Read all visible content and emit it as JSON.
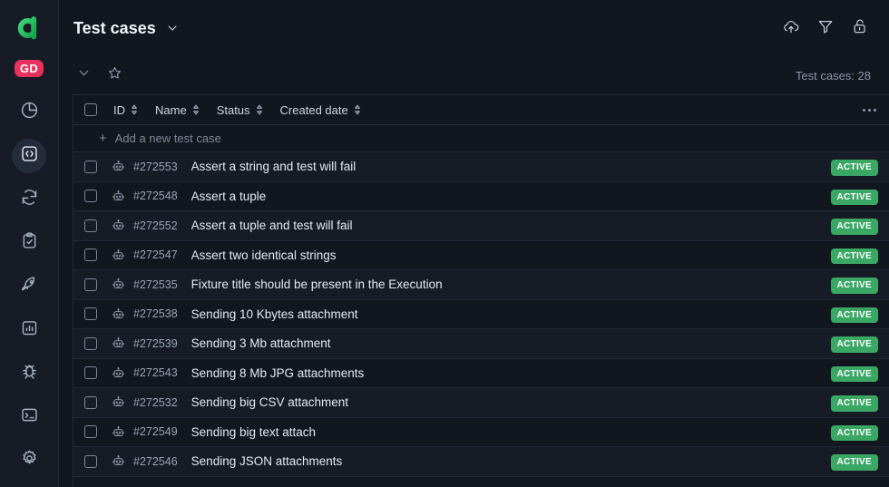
{
  "sidebar": {
    "logo_icon": "allure-logo-icon",
    "avatar_initials": "GD",
    "items": [
      {
        "icon": "pie-chart-icon",
        "name": "dashboards",
        "active": false
      },
      {
        "icon": "code-brackets-icon",
        "name": "test-cases",
        "active": true
      },
      {
        "icon": "sync-icon",
        "name": "launches",
        "active": false
      },
      {
        "icon": "clipboard-check-icon",
        "name": "test-plans",
        "active": false
      },
      {
        "icon": "rocket-icon",
        "name": "jobs",
        "active": false
      },
      {
        "icon": "bar-chart-icon",
        "name": "analytics",
        "active": false
      },
      {
        "icon": "bug-icon",
        "name": "defects",
        "active": false
      },
      {
        "icon": "terminal-icon",
        "name": "console",
        "active": false
      },
      {
        "icon": "gear-icon",
        "name": "settings",
        "active": false
      }
    ]
  },
  "topbar": {
    "title": "Test cases",
    "title_chevron_icon": "chevron-down-icon",
    "actions": [
      {
        "icon": "cloud-upload-icon",
        "name": "upload-button"
      },
      {
        "icon": "filter-icon",
        "name": "filter-button"
      },
      {
        "icon": "unlock-icon",
        "name": "lock-button"
      }
    ]
  },
  "subbar": {
    "collapse_icon": "chevron-down-icon",
    "favorite_icon": "star-icon",
    "count_label": "Test cases: 28"
  },
  "table": {
    "select_all_name": "select-all-checkbox",
    "columns": [
      {
        "label": "ID",
        "sortable": true
      },
      {
        "label": "Name",
        "sortable": true
      },
      {
        "label": "Status",
        "sortable": true
      },
      {
        "label": "Created date",
        "sortable": true
      }
    ],
    "more_menu_icon": "more-options-icon",
    "add_row": {
      "icon": "plus-icon",
      "label": "Add a new test case"
    },
    "row_icon": "robot-icon",
    "rows": [
      {
        "id": "#272553",
        "name": "Assert a string and test will fail",
        "status": "ACTIVE"
      },
      {
        "id": "#272548",
        "name": "Assert a tuple",
        "status": "ACTIVE"
      },
      {
        "id": "#272552",
        "name": "Assert a tuple and test will fail",
        "status": "ACTIVE"
      },
      {
        "id": "#272547",
        "name": "Assert two identical strings",
        "status": "ACTIVE"
      },
      {
        "id": "#272535",
        "name": "Fixture title should be present in the Execution",
        "status": "ACTIVE"
      },
      {
        "id": "#272538",
        "name": "Sending 10 Kbytes attachment",
        "status": "ACTIVE"
      },
      {
        "id": "#272539",
        "name": "Sending 3 Mb attachment",
        "status": "ACTIVE"
      },
      {
        "id": "#272543",
        "name": "Sending 8 Mb JPG attachments",
        "status": "ACTIVE"
      },
      {
        "id": "#272532",
        "name": "Sending big CSV attachment",
        "status": "ACTIVE"
      },
      {
        "id": "#272549",
        "name": "Sending big text attach",
        "status": "ACTIVE"
      },
      {
        "id": "#272546",
        "name": "Sending JSON attachments",
        "status": "ACTIVE"
      }
    ]
  },
  "colors": {
    "app_bg": "#12161f",
    "sidebar_bg": "#161b26",
    "row_alt_bg": "#161b26",
    "border": "#242a38",
    "accent_green": "#3aa864",
    "avatar_pink": "#e8315c",
    "logo_green": "#2fbf62",
    "text_primary": "#e3e9f2",
    "text_muted": "#8b94a6"
  }
}
